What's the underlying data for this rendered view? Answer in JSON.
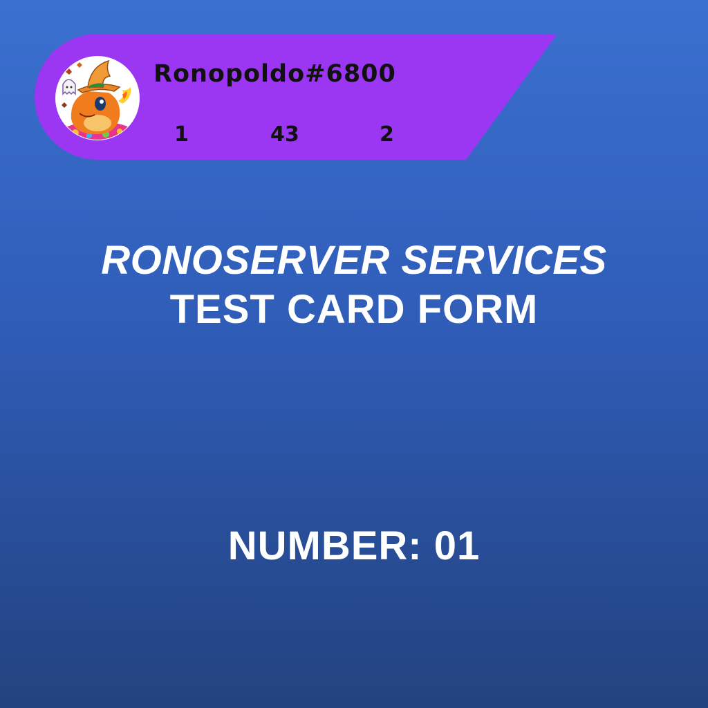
{
  "profile": {
    "username": "Ronopoldo#6800",
    "stats": [
      "1",
      "43",
      "2"
    ],
    "avatar_icon": "charmander-witch-avatar-icon",
    "banner_color": "#9b36f3"
  },
  "card": {
    "title_line_1": "RONOSERVER SERVICES",
    "title_line_2": "TEST CARD FORM",
    "number_label": "NUMBER: 01"
  },
  "colors": {
    "background_top": "#3b70d0",
    "background_bottom": "#23427f",
    "text": "#ffffff",
    "banner_text": "#111111"
  }
}
